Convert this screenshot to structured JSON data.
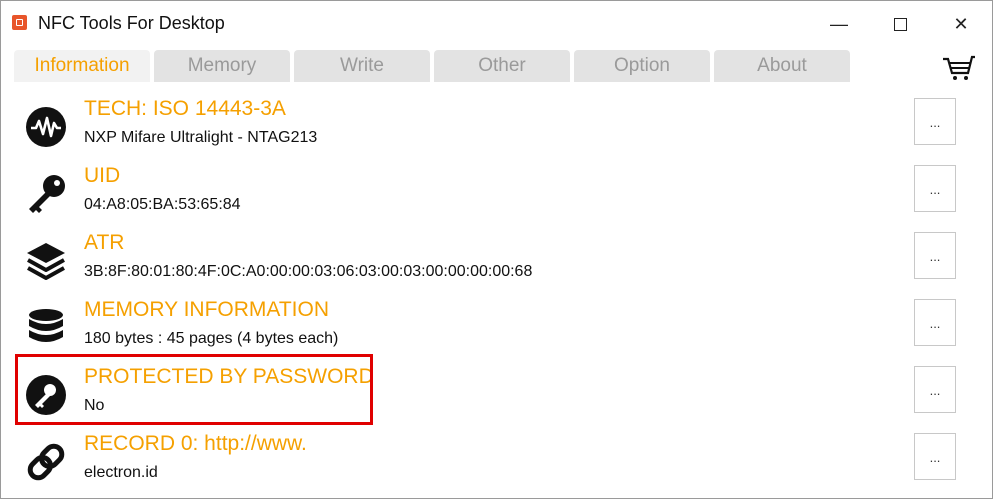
{
  "window": {
    "title": "NFC Tools For Desktop",
    "controls": {
      "minimize": "—",
      "close": "✕"
    }
  },
  "tabs": [
    {
      "label": "Information",
      "active": true
    },
    {
      "label": "Memory",
      "active": false
    },
    {
      "label": "Write",
      "active": false
    },
    {
      "label": "Other",
      "active": false
    },
    {
      "label": "Option",
      "active": false
    },
    {
      "label": "About",
      "active": false
    }
  ],
  "toolbar": {
    "cart_icon": "cart-icon"
  },
  "rows": [
    {
      "icon": "waveform-icon",
      "title": "TECH: ISO 14443-3A",
      "value": "NXP Mifare Ultralight - NTAG213",
      "button": "..."
    },
    {
      "icon": "key-icon",
      "title": "UID",
      "value": "04:A8:05:BA:53:65:84",
      "button": "..."
    },
    {
      "icon": "layers-icon",
      "title": "ATR",
      "value": "3B:8F:80:01:80:4F:0C:A0:00:00:03:06:03:00:03:00:00:00:00:68",
      "button": "..."
    },
    {
      "icon": "database-icon",
      "title": "MEMORY INFORMATION",
      "value": "180 bytes : 45 pages (4 bytes each)",
      "button": "..."
    },
    {
      "icon": "password-key-icon",
      "title": "PROTECTED BY PASSWORD",
      "value": "No",
      "button": "...",
      "highlighted": true
    },
    {
      "icon": "link-icon",
      "title": "RECORD 0: http://www.",
      "value": "electron.id",
      "button": "..."
    }
  ],
  "colors": {
    "accent": "#f5a000",
    "highlight_border": "#e00000",
    "tab_inactive_bg": "#e3e3e3",
    "tab_active_bg": "#f2f2f2"
  }
}
